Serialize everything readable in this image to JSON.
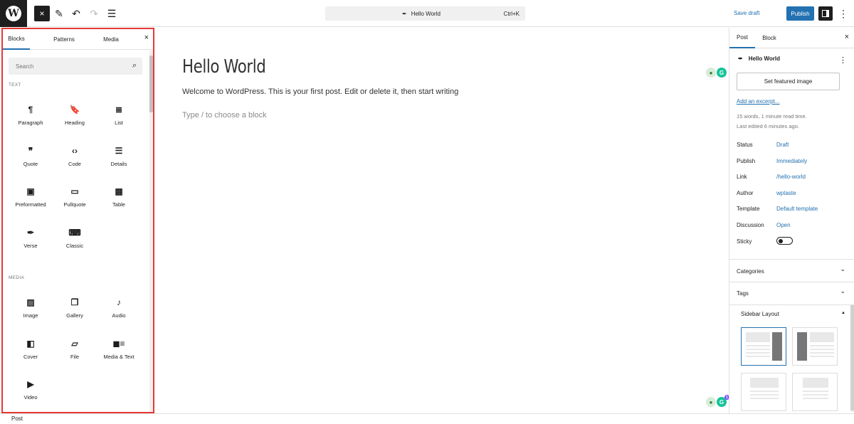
{
  "topbar": {
    "logo_letter": "W",
    "close_icon": "×",
    "tools_icon": "✎",
    "undo_icon": "↶",
    "redo_icon": "↷",
    "outline_icon": "☰",
    "command": {
      "title": "Hello World",
      "shortcut": "Ctrl+K"
    },
    "save_draft": "Save draft",
    "publish": "Publish",
    "more_icon": "⋮"
  },
  "inserter": {
    "tabs": [
      "Blocks",
      "Patterns",
      "Media"
    ],
    "active_tab": "Blocks",
    "close": "×",
    "search_placeholder": "Search",
    "categories": [
      {
        "label": "TEXT",
        "blocks": [
          {
            "label": "Paragraph",
            "icon": "¶",
            "icon_name": "paragraph-icon"
          },
          {
            "label": "Heading",
            "icon": "🔖",
            "icon_name": "heading-icon"
          },
          {
            "label": "List",
            "icon": "≣",
            "icon_name": "list-icon"
          },
          {
            "label": "Quote",
            "icon": "❞",
            "icon_name": "quote-icon"
          },
          {
            "label": "Code",
            "icon": "‹›",
            "icon_name": "code-icon"
          },
          {
            "label": "Details",
            "icon": "☰",
            "icon_name": "details-icon"
          },
          {
            "label": "Preformatted",
            "icon": "▣",
            "icon_name": "preformatted-icon"
          },
          {
            "label": "Pullquote",
            "icon": "▭",
            "icon_name": "pullquote-icon"
          },
          {
            "label": "Table",
            "icon": "▦",
            "icon_name": "table-icon"
          },
          {
            "label": "Verse",
            "icon": "✒",
            "icon_name": "verse-icon"
          },
          {
            "label": "Classic",
            "icon": "⌨",
            "icon_name": "classic-icon"
          }
        ]
      },
      {
        "label": "MEDIA",
        "blocks": [
          {
            "label": "Image",
            "icon": "▨",
            "icon_name": "image-icon"
          },
          {
            "label": "Gallery",
            "icon": "❐",
            "icon_name": "gallery-icon"
          },
          {
            "label": "Audio",
            "icon": "♪",
            "icon_name": "audio-icon"
          },
          {
            "label": "Cover",
            "icon": "◧",
            "icon_name": "cover-icon"
          },
          {
            "label": "File",
            "icon": "▱",
            "icon_name": "file-icon"
          },
          {
            "label": "Media & Text",
            "icon": "◼≡",
            "icon_name": "media-text-icon"
          },
          {
            "label": "Video",
            "icon": "▶",
            "icon_name": "video-icon"
          }
        ]
      }
    ]
  },
  "editor": {
    "title": "Hello World",
    "body": "Welcome to WordPress. This is your first post. Edit or delete it, then start writing",
    "placeholder": "Type / to choose a block",
    "grammarly_badge": "1"
  },
  "settings": {
    "tabs": [
      "Post",
      "Block"
    ],
    "active_tab": "Post",
    "close": "×",
    "post_title": "Hello World",
    "featured_image": "Set featured image",
    "excerpt_link": "Add an excerpt...",
    "meta_line1": "15 words, 1 minute read time.",
    "meta_line2": "Last edited 6 minutes ago.",
    "fields": [
      {
        "label": "Status",
        "value": "Draft"
      },
      {
        "label": "Publish",
        "value": "Immediately"
      },
      {
        "label": "Link",
        "value": "/hello-world"
      },
      {
        "label": "Author",
        "value": "wptaste"
      },
      {
        "label": "Template",
        "value": "Default template"
      },
      {
        "label": "Discussion",
        "value": "Open"
      }
    ],
    "sticky_label": "Sticky",
    "sticky_on": false,
    "panels": [
      {
        "label": "Categories",
        "chevron": "⌄"
      },
      {
        "label": "Tags",
        "chevron": "⌄"
      }
    ],
    "sidebar_layout": {
      "title": "Sidebar Layout",
      "caret": "▲",
      "selected_index": 0
    }
  },
  "footer": {
    "breadcrumb": "Post"
  },
  "colors": {
    "accent": "#2271b1",
    "dark": "#1e1e1e",
    "highlight_border": "#e53935"
  }
}
